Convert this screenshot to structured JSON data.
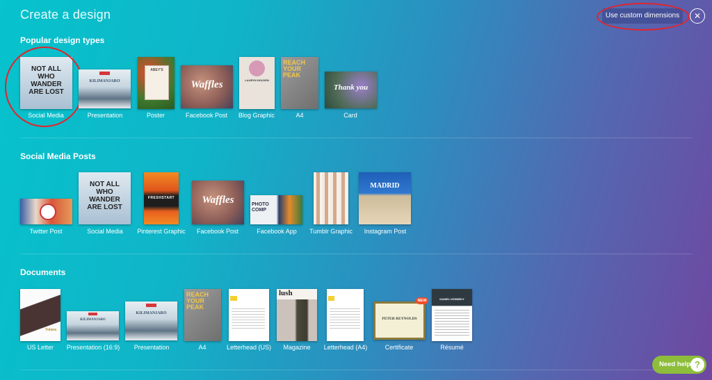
{
  "header": {
    "title": "Create a design",
    "custom_dimensions_label": "Use custom dimensions",
    "close_glyph": "✕"
  },
  "sections": [
    {
      "title": "Popular design types",
      "items": [
        {
          "label": "Social Media",
          "thumb_text": "NOT ALL WHO WANDER ARE LOST"
        },
        {
          "label": "Presentation",
          "thumb_text": "KILIMANJARO"
        },
        {
          "label": "Poster",
          "thumb_text": "ABEY'S"
        },
        {
          "label": "Facebook Post",
          "thumb_text": "Waffles"
        },
        {
          "label": "Blog Graphic",
          "thumb_text": "LAURYN HOLDEN"
        },
        {
          "label": "A4",
          "thumb_text": "REACH YOUR PEAK"
        },
        {
          "label": "Card",
          "thumb_text": "Thank you"
        }
      ]
    },
    {
      "title": "Social Media Posts",
      "items": [
        {
          "label": "Twitter Post",
          "thumb_text": ""
        },
        {
          "label": "Social Media",
          "thumb_text": "NOT ALL WHO WANDER ARE LOST"
        },
        {
          "label": "Pinterest Graphic",
          "thumb_text": "FRESHSTART"
        },
        {
          "label": "Facebook Post",
          "thumb_text": "Waffles"
        },
        {
          "label": "Facebook App",
          "thumb_text": "PHOTO COMP"
        },
        {
          "label": "Tumblr Graphic",
          "thumb_text": ""
        },
        {
          "label": "Instagram Post",
          "thumb_text": "MADRID"
        }
      ]
    },
    {
      "title": "Documents",
      "items": [
        {
          "label": "US Letter",
          "thumb_text": "Yolana"
        },
        {
          "label": "Presentation (16:9)",
          "thumb_text": "KILIMANJARO"
        },
        {
          "label": "Presentation",
          "thumb_text": "KILIMANJARO"
        },
        {
          "label": "A4",
          "thumb_text": "REACH YOUR PEAK"
        },
        {
          "label": "Letterhead (US)",
          "thumb_text": ""
        },
        {
          "label": "Magazine",
          "thumb_text": "lush"
        },
        {
          "label": "Letterhead (A4)",
          "thumb_text": ""
        },
        {
          "label": "Certificate",
          "thumb_text": "PETER REYNOLDS",
          "badge": "NEW"
        },
        {
          "label": "Résumé",
          "thumb_text": "DANIEL KENNEDY"
        }
      ]
    }
  ],
  "help": {
    "label": "Need help",
    "icon_glyph": "?"
  },
  "colors": {
    "gradient_start": "#06c3cc",
    "gradient_end": "#6f47a1",
    "annotation_red": "#e3242b",
    "help_green": "#8dbd3a",
    "new_badge": "#f14e2b"
  }
}
